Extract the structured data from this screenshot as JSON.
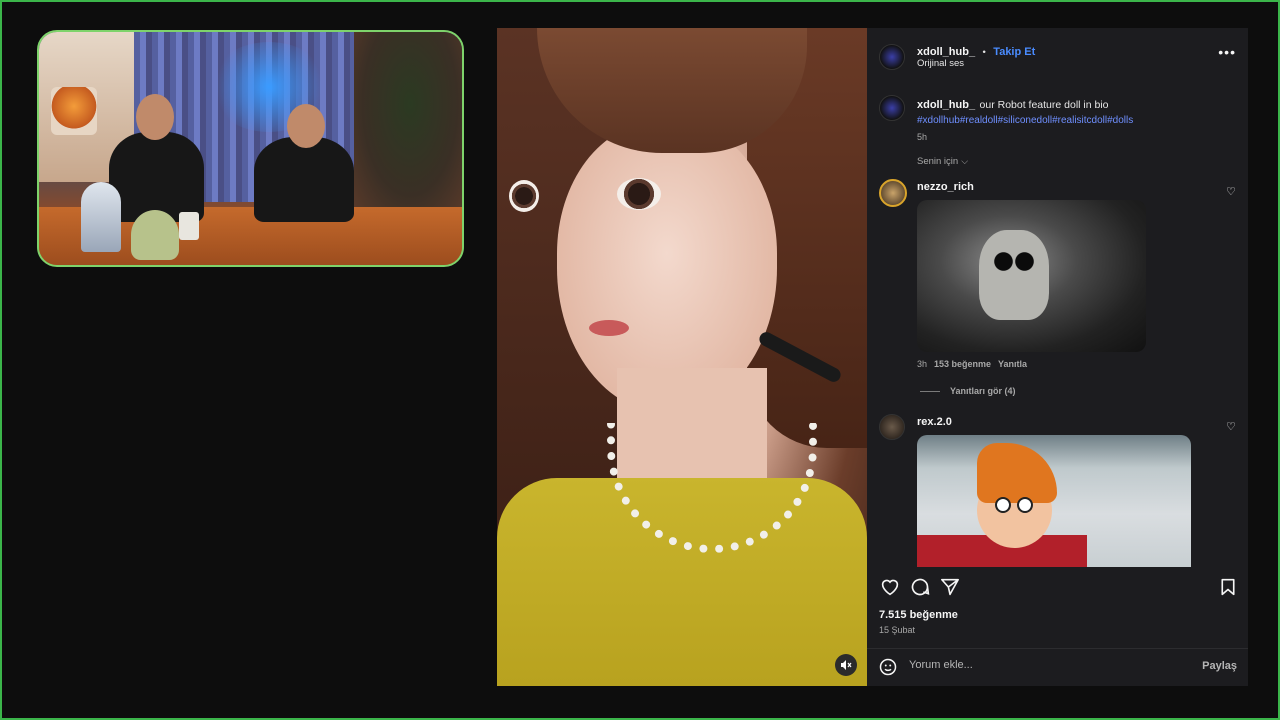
{
  "post": {
    "author": "xdoll_hub_",
    "follow_label": "Takip Et",
    "separator": "•",
    "audio": "Orijinal ses",
    "more_icon": "more-horizontal-icon",
    "caption_author": "xdoll_hub_",
    "caption_text": "our Robot feature doll in bio",
    "caption_hashtags": "#xdollhub#realdoll#siliconedoll#realisitcdoll#dolls",
    "caption_time": "5h",
    "filter_label": "Senin için",
    "likes": "7.515 beğenme",
    "date": "15 Şubat",
    "comment_placeholder": "Yorum ekle...",
    "share_label": "Paylaş",
    "mute_icon": "speaker-muted-icon"
  },
  "comments": [
    {
      "user": "nezzo_rich",
      "time": "3h",
      "likes": "153 beğenme",
      "reply": "Yanıtla",
      "view_replies": "Yanıtları gör (4)"
    },
    {
      "user": "rex.2.0"
    }
  ],
  "actions": {
    "like_icon": "heart-icon",
    "comment_icon": "comment-icon",
    "share_icon": "send-icon",
    "save_icon": "bookmark-icon"
  },
  "colors": {
    "accent": "#4a8cff",
    "hashtag": "#6f8fff",
    "frame": "#3bb54a",
    "panel": "#1c1c1f"
  }
}
